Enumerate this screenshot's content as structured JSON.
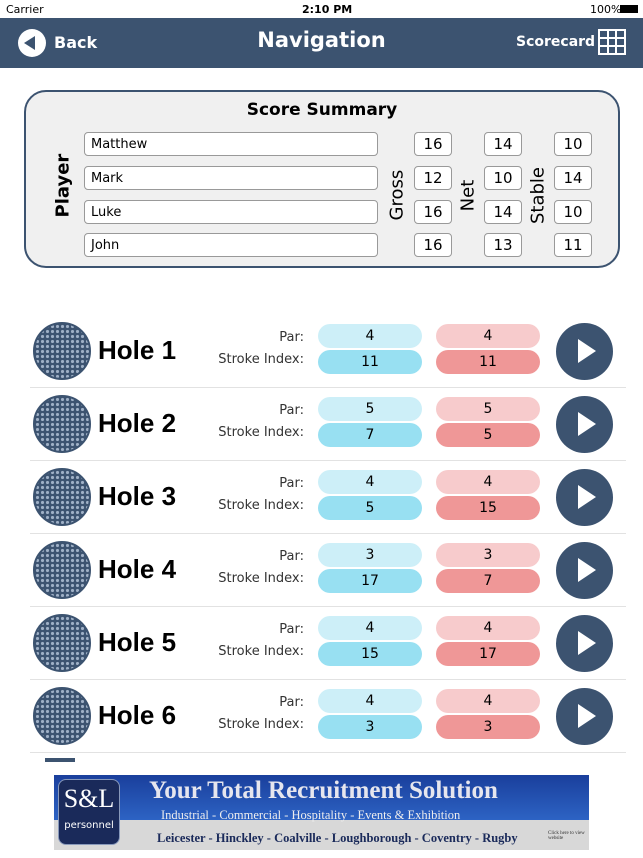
{
  "status": {
    "carrier": "Carrier",
    "time": "2:10 PM",
    "battery": "100%"
  },
  "nav": {
    "back": "Back",
    "title": "Navigation",
    "scorecard": "Scorecard"
  },
  "summary": {
    "title": "Score Summary",
    "player_label": "Player",
    "gross_label": "Gross",
    "net_label": "Net",
    "stable_label": "Stable",
    "players": [
      {
        "name": "Matthew",
        "gross": "16",
        "net": "14",
        "stable": "10"
      },
      {
        "name": "Mark",
        "gross": "12",
        "net": "10",
        "stable": "14"
      },
      {
        "name": "Luke",
        "gross": "16",
        "net": "14",
        "stable": "10"
      },
      {
        "name": "John",
        "gross": "16",
        "net": "13",
        "stable": "11"
      }
    ]
  },
  "labels": {
    "par": "Par:",
    "si": "Stroke Index:"
  },
  "holes": [
    {
      "name": "Hole 1",
      "par_a": "4",
      "si_a": "11",
      "par_b": "4",
      "si_b": "11"
    },
    {
      "name": "Hole 2",
      "par_a": "5",
      "si_a": "7",
      "par_b": "5",
      "si_b": "5"
    },
    {
      "name": "Hole 3",
      "par_a": "4",
      "si_a": "5",
      "par_b": "4",
      "si_b": "15"
    },
    {
      "name": "Hole 4",
      "par_a": "3",
      "si_a": "17",
      "par_b": "3",
      "si_b": "7"
    },
    {
      "name": "Hole 5",
      "par_a": "4",
      "si_a": "15",
      "par_b": "4",
      "si_b": "17"
    },
    {
      "name": "Hole 6",
      "par_a": "4",
      "si_a": "3",
      "par_b": "4",
      "si_b": "3"
    }
  ],
  "banner": {
    "logo": "S&L",
    "logo_sub": "personnel",
    "headline": "Your Total Recruitment Solution",
    "sectors": "Industrial - Commercial - Hospitality - Events & Exhibition",
    "towns": "Leicester - Hinckley - Coalville - Loughborough - Coventry - Rugby",
    "cta": "Click here to view website"
  },
  "colors": {
    "nav": "#3c5370",
    "par_blue": "#cdeff8",
    "si_blue": "#98e0f2",
    "par_pink": "#f7cbcc",
    "si_pink": "#ef9797"
  }
}
